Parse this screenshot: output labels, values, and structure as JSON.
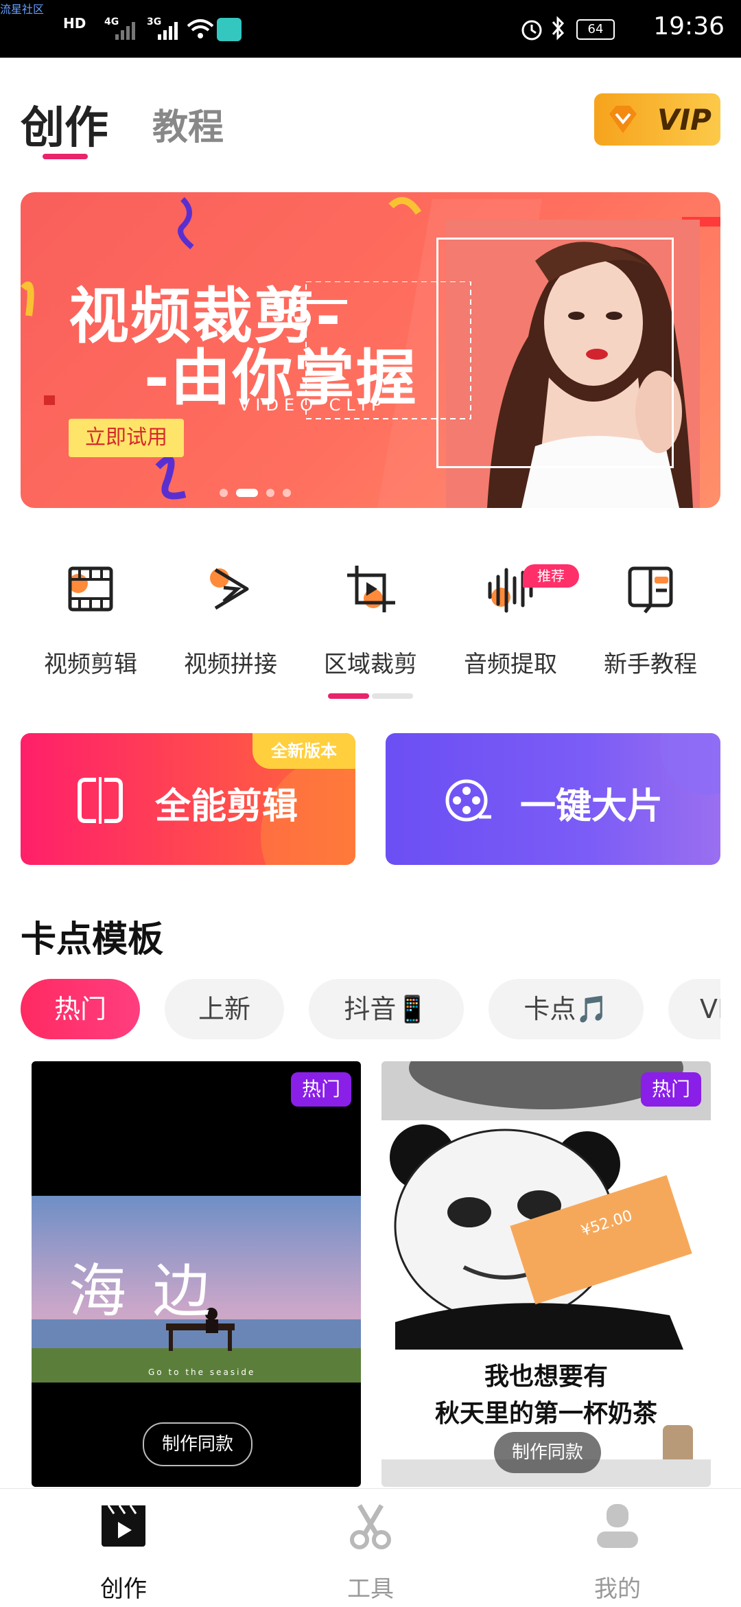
{
  "status_bar": {
    "watermark": "流星社区",
    "hd": "HD",
    "net1": "4G",
    "net2": "3G",
    "battery": "64",
    "time": "19:36"
  },
  "header": {
    "tabs": [
      {
        "label": "创作",
        "active": true
      },
      {
        "label": "教程",
        "active": false
      }
    ],
    "vip_label": "VIP"
  },
  "banner": {
    "title_line1": "视频裁剪-",
    "title_line2": "-由你掌握",
    "subtitle": "VIDEO CLIP",
    "cta": "立即试用",
    "pages": 4,
    "active_page": 2
  },
  "tools": [
    {
      "label": "视频剪辑",
      "icon": "film-strip-icon"
    },
    {
      "label": "视频拼接",
      "icon": "play-join-icon"
    },
    {
      "label": "区域裁剪",
      "icon": "crop-icon"
    },
    {
      "label": "音频提取",
      "icon": "audio-wave-icon",
      "badge": "推荐"
    },
    {
      "label": "新手教程",
      "icon": "book-icon"
    }
  ],
  "promos": [
    {
      "label": "全能剪辑",
      "tag": "全新版本",
      "icon": "split-clip-icon"
    },
    {
      "label": "一键大片",
      "icon": "film-reel-icon"
    }
  ],
  "section": {
    "title": "卡点模板",
    "chips": [
      "热门",
      "上新",
      "抖音📱",
      "卡点🎵",
      "VI"
    ],
    "active_chip": 0
  },
  "templates": [
    {
      "badge": "热门",
      "overlay_title": "海  边",
      "overlay_sub": "Go to the seaside",
      "action": "制作同款"
    },
    {
      "badge": "热门",
      "caption_line1": "我也想要有",
      "caption_line2": "秋天里的第一杯奶茶",
      "ticket": "¥52.00",
      "action": "制作同款"
    }
  ],
  "bottom_nav": [
    {
      "label": "创作",
      "icon": "clapper-play-icon",
      "active": true
    },
    {
      "label": "工具",
      "icon": "scissors-icon",
      "active": false
    },
    {
      "label": "我的",
      "icon": "user-icon",
      "active": false
    }
  ],
  "colors": {
    "accent": "#e8246a",
    "vip": "#f6a31c",
    "badge_purple": "#8a1fe8"
  }
}
